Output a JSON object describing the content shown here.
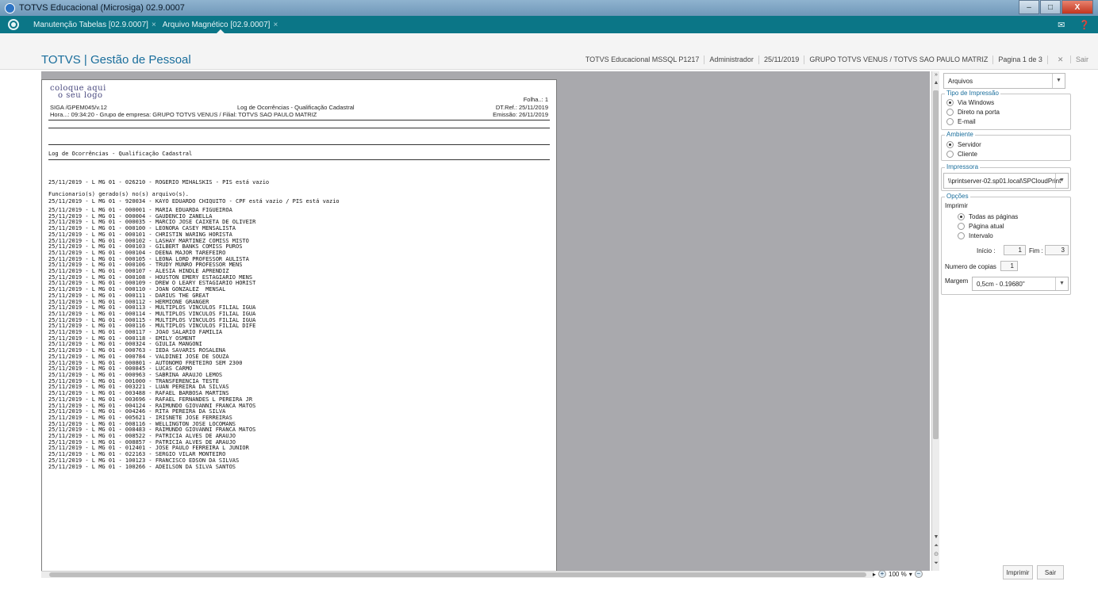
{
  "window": {
    "title": "TOTVS Educacional (Microsiga) 02.9.0007",
    "minimize": "–",
    "maximize": "□",
    "close": "X"
  },
  "tabs": [
    {
      "label": "Manutenção Tabelas [02.9.0007]",
      "close": "×"
    },
    {
      "label": "Arquivo Magnético [02.9.0007]",
      "close": "×"
    }
  ],
  "tabbar_icons": {
    "mail": "✉",
    "help": "❓"
  },
  "header": {
    "brand": "TOTVS | Gestão de Pessoal",
    "environment": "TOTVS Educacional MSSQL P1217",
    "user": "Administrador",
    "date": "25/11/2019",
    "company": "GRUPO TOTVS VENUS / TOTVS SAO PAULO MATRIZ",
    "page": "Pagina 1 de 3",
    "exit_icon": "✕",
    "exit": "Sair"
  },
  "report": {
    "logo_line1": "coloque aqui",
    "logo_line2": "o seu logo",
    "program": "SIGA /GPEM045/v.12",
    "time_line": "Hora...: 09:34:20 - Grupo de empresa: GRUPO TOTVS VENUS / Filial: TOTVS SAO PAULO MATRIZ",
    "title": "Log de Ocorrências - Qualificação Cadastral",
    "folha": "Folha..:    1",
    "dtref": "DT.Ref.: 25/11/2019",
    "emissao": "Emissão: 26/11/2019",
    "section_title": "Log de Ocorrências - Qualificação Cadastral",
    "errors": [
      "25/11/2019 - L MG 01 - 026210 - ROGERIO MIHALSKIS - PIS está vazio",
      "25/11/2019 - L MG 01 - 920034 - KAYO EDUARDO CHIQUITO - CPF está vazio / PIS está vazio"
    ],
    "generated_title": "Funcionario(s) gerado(s) no(s) arquivo(s).",
    "employees": [
      "25/11/2019 - L MG 01 - 000001 - MARIA EDUARDA FIGUEIROA",
      "25/11/2019 - L MG 01 - 000004 - GAUDENCIO ZANELLA",
      "25/11/2019 - L MG 01 - 000035 - MARCIO JOSE CAIXETA DE OLIVEIR",
      "25/11/2019 - L MG 01 - 000100 - LEONORA CASEY MENSALISTA",
      "25/11/2019 - L MG 01 - 000101 - CHRISTIN WARING HORISTA",
      "25/11/2019 - L MG 01 - 000102 - LASHAY MARTINEZ COMISS MISTO",
      "25/11/2019 - L MG 01 - 000103 - GILBERT BANKS COMISS PUROS",
      "25/11/2019 - L MG 01 - 000104 - DEENA MAJOR TAREFEIRO",
      "25/11/2019 - L MG 01 - 000105 - LEONA LORD PROFESSOR AULISTA",
      "25/11/2019 - L MG 01 - 000106 - TRUDY MUNRO PROFESSOR MENS",
      "25/11/2019 - L MG 01 - 000107 - ALESIA HINDLE APRENDIZ",
      "25/11/2019 - L MG 01 - 000108 - HOUSTON EMERY ESTAGIARIO MENS",
      "25/11/2019 - L MG 01 - 000109 - DREW O LEARY ESTAGIARIO HORIST",
      "25/11/2019 - L MG 01 - 000110 - JOAN GONZALEZ  MENSAL",
      "25/11/2019 - L MG 01 - 000111 - DARIUS THE GREAT",
      "25/11/2019 - L MG 01 - 000112 - HERMIONE GRANGER",
      "25/11/2019 - L MG 01 - 000113 - MULTIPLOS VINCULOS FILIAL IGUA",
      "25/11/2019 - L MG 01 - 000114 - MULTIPLOS VINCULOS FILIAL IGUA",
      "25/11/2019 - L MG 01 - 000115 - MULTIPLOS VINCULOS FILIAL IGUA",
      "25/11/2019 - L MG 01 - 000116 - MULTIPLOS VINCULOS FILIAL DIFE",
      "25/11/2019 - L MG 01 - 000117 - JOAO SALARIO FAMILIA",
      "25/11/2019 - L MG 01 - 000118 - EMILY OSMENT",
      "25/11/2019 - L MG 01 - 000324 - GIULIA MANGONI",
      "25/11/2019 - L MG 01 - 000763 - IEDA SAVARIS ROSALENA",
      "25/11/2019 - L MG 01 - 000784 - VALDINEI JOSE DE SOUZA",
      "25/11/2019 - L MG 01 - 000801 - AUTONOMO FRETEIRO SEM 2300",
      "25/11/2019 - L MG 01 - 000845 - LUCAS CARMO",
      "25/11/2019 - L MG 01 - 000963 - SABRINA ARAUJO LEMOS",
      "25/11/2019 - L MG 01 - 001000 - TRANSFERENCIA TESTE",
      "25/11/2019 - L MG 01 - 003221 - LUAN PEREIRA DA SILVAS",
      "25/11/2019 - L MG 01 - 003488 - RAFAEL BARBOSA MARTINS",
      "25/11/2019 - L MG 01 - 003696 - RAFAEL FERNANDES L PEREIRA JR",
      "25/11/2019 - L MG 01 - 004124 - RAIMUNDO GIOVANNI FRANCA MATOS",
      "25/11/2019 - L MG 01 - 004246 - RITA PEREIRA DA SILVA",
      "25/11/2019 - L MG 01 - 005621 - IRISNETE JOSE FERREIRAS",
      "25/11/2019 - L MG 01 - 008116 - WELLINGTON JOSE LOCOMANS",
      "25/11/2019 - L MG 01 - 008483 - RAIMUNDO GIOVANNI FRANCA MATOS",
      "25/11/2019 - L MG 01 - 008522 - PATRICIA ALVES DE ARAUJO",
      "25/11/2019 - L MG 01 - 008857 - PATRICIA ALVES DE ARAUJO",
      "25/11/2019 - L MG 01 - 012401 - JOSE PAULO FERREIRA L JUNIOR",
      "25/11/2019 - L MG 01 - 022163 - SERGIO VILAR MONTEIRO",
      "25/11/2019 - L MG 01 - 100123 - FRANCISCO EDSON DA SILVAS",
      "25/11/2019 - L MG 01 - 100266 - ADEILSON DA SILVA SANTOS"
    ]
  },
  "zoom": {
    "value": "100 %",
    "in": "+",
    "out": "−",
    "arrow": "▾"
  },
  "panel": {
    "output_select": "Arquivos",
    "print_type": {
      "title": "Tipo de Impressão",
      "options": [
        "Via Windows",
        "Direto na porta",
        "E-mail"
      ],
      "selected": 0
    },
    "environment": {
      "title": "Ambiente",
      "options": [
        "Servidor",
        "Cliente"
      ],
      "selected": 0
    },
    "printer": {
      "title": "Impressora",
      "value": "\\\\printserver-02.sp01.local\\SPCloudPrint"
    },
    "options": {
      "title": "Opções",
      "print_label": "Imprimir",
      "pages": [
        "Todas as páginas",
        "Página atual",
        "Intervalo"
      ],
      "selected": 0,
      "start_label": "Início :",
      "start_value": "1",
      "end_label": "Fim :",
      "end_value": "3",
      "copies_label": "Numero de copias",
      "copies_value": "1",
      "margin_label": "Margem",
      "margin_value": "0,5cm - 0.19680\""
    },
    "print_button": "Imprimir",
    "exit_button": "Sair"
  },
  "arrows": {
    "down": "▼",
    "up": "▲",
    "collapse": "»",
    "first": "⏶",
    "last": "⏷",
    "mid": "⊙",
    "left": "◂",
    "right": "▸"
  }
}
